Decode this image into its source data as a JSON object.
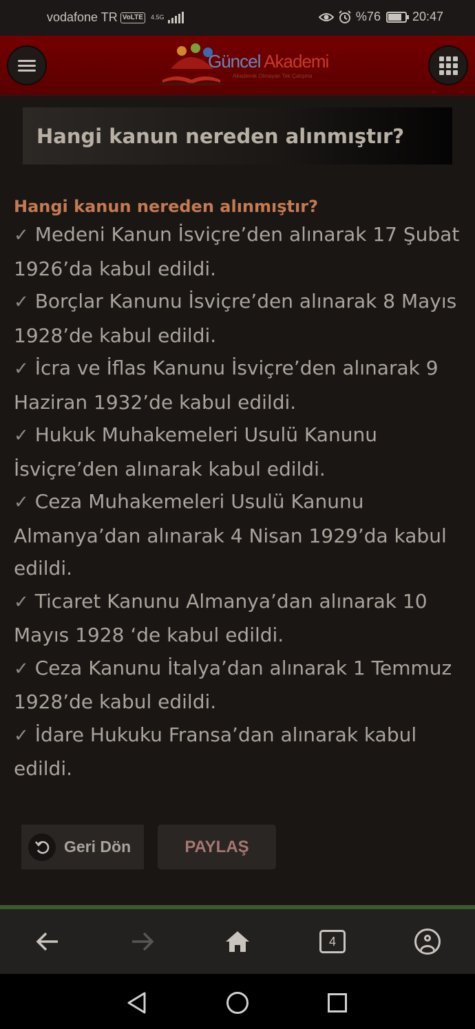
{
  "status_bar": {
    "carrier": "vodafone TR",
    "volte": "VoLTE",
    "network": "4.5G",
    "battery": "%76",
    "battery_level": 0.76,
    "time": "20:47"
  },
  "header": {
    "logo_text_a": "Güncel",
    "logo_text_b": " Akademi",
    "logo_subtitle": "Akademik Olmayan Tek Çalışma"
  },
  "page": {
    "title": "Hangi kanun nereden alınmıştır?"
  },
  "article": {
    "heading": "Hangi kanun nereden alınmıştır?",
    "check_mark": "✓",
    "items": [
      "Medeni Kanun İsviçre’den alınarak 17 Şubat 1926’da kabul edildi.",
      "Borçlar Kanunu İsviçre’den alınarak 8 Mayıs 1928’de kabul edildi.",
      "İcra ve İflas Kanunu İsviçre’den alınarak 9 Haziran 1932’de kabul edildi.",
      "Hukuk Muhakemeleri Usulü Kanunu İsviçre’den alınarak kabul edildi.",
      "Ceza Muhakemeleri Usulü Kanunu Almanya’dan alınarak 4 Nisan 1929’da kabul edildi.",
      "Ticaret Kanunu Almanya’dan alınarak 10 Mayıs 1928 ‘de kabul edildi.",
      "Ceza Kanunu İtalya’dan alınarak 1 Temmuz 1928’de kabul edildi.",
      "İdare Hukuku Fransa’dan alınarak kabul edildi."
    ]
  },
  "actions": {
    "back_label": "Geri Dön",
    "share_label": "PAYLAŞ"
  },
  "browser_bar": {
    "tab_count": "4"
  },
  "colors": {
    "header_red": "#740000",
    "heading_orange": "#c47a52",
    "share_text": "#a67872",
    "accent_green": "#3c5a2c"
  }
}
